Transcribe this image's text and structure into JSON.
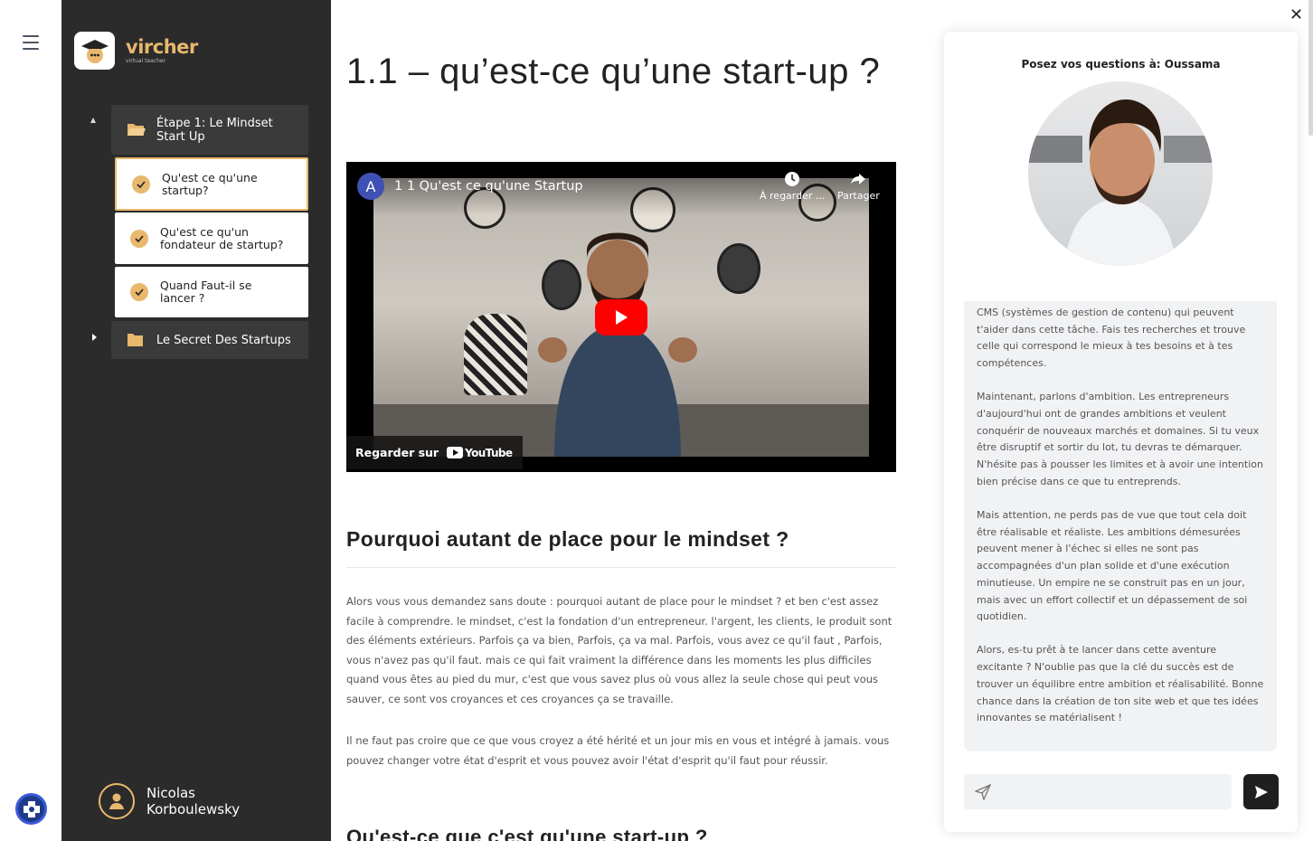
{
  "app": {
    "logo_name": "vircher",
    "logo_tagline": "virtual teacher"
  },
  "sidebar": {
    "modules": [
      {
        "label": "Étape 1: Le Mindset Start Up",
        "lessons": [
          {
            "label": "Qu'est ce qu'une startup?",
            "done": true,
            "active": true
          },
          {
            "label": "Qu'est ce qu'un fondateur de startup?",
            "done": true,
            "active": false
          },
          {
            "label": "Quand Faut-il se lancer ?",
            "done": true,
            "active": false
          }
        ]
      },
      {
        "label": "Le Secret Des Startups"
      }
    ],
    "user_name": "Nicolas Korboulewsky"
  },
  "main": {
    "title": "1.1 – qu’est-ce qu’une start-up ?",
    "video": {
      "channel_initial": "A",
      "title": "1 1 Qu'est ce qu'une Startup",
      "watch_later": "À regarder ...",
      "share": "Partager",
      "watch_on": "Regarder sur",
      "youtube": "YouTube"
    },
    "section1_title": "Pourquoi autant de place pour le mindset ?",
    "paragraph1": "Alors vous vous demandez sans doute : pourquoi autant de place pour le mindset ? et ben c'est assez facile à comprendre. le mindset, c'est la fondation d'un entrepreneur. l'argent, les clients, le produit sont des éléments extérieurs. Parfois ça va bien, Parfois, ça va mal. Parfois, vous avez ce qu'il faut , Parfois, vous n'avez pas qu'il faut. mais ce qui fait vraiment la différence dans les moments les plus difficiles quand vous êtes au pied du mur, c'est que vous savez plus où vous allez la seule chose qui peut vous sauver, ce sont vos croyances et ces croyances ça se travaille.",
    "paragraph2": "Il ne faut pas croire que ce que vous croyez a été hérité et un jour mis en vous et intégré à jamais. vous pouvez changer votre état d'esprit et vous pouvez avoir l'état d'esprit qu'il faut pour réussir.",
    "section2_title": "Qu'est-ce que c'est qu'une start-up ?"
  },
  "chat": {
    "title": "Posez vos questions à: Oussama",
    "messages": [
      "CMS (systèmes de gestion de contenu) qui peuvent t'aider dans cette tâche. Fais tes recherches et trouve celle qui correspond le mieux à tes besoins et à tes compétences.",
      "Maintenant, parlons d'ambition. Les entrepreneurs d'aujourd'hui ont de grandes ambitions et veulent conquérir de nouveaux marchés et domaines. Si tu veux être disruptif et sortir du lot, tu devras te démarquer. N'hésite pas à pousser les limites et à avoir une intention bien précise dans ce que tu entreprends.",
      "Mais attention, ne perds pas de vue que tout cela doit être réalisable et réaliste. Les ambitions démesurées peuvent mener à l'échec si elles ne sont pas accompagnées d'un plan solide et d'une exécution minutieuse. Un empire ne se construit pas en un jour, mais avec un effort collectif et un dépassement de soi quotidien.",
      "Alors, es-tu prêt à te lancer dans cette aventure excitante ? N'oublie pas que la clé du succès est de trouver un équilibre entre ambition et réalisabilité. Bonne chance dans la création de ton site web et que tes idées innovantes se matérialisent !"
    ],
    "input_placeholder": ""
  },
  "colors": {
    "accent": "#e8b86d",
    "sidebar_bg": "#2b2b2b",
    "youtube_red": "#ff0000"
  },
  "icons": [
    "hamburger-icon",
    "folder-icon",
    "check-icon",
    "user-icon",
    "clock-icon",
    "share-icon",
    "play-icon",
    "send-icon",
    "paper-plane-icon",
    "close-icon"
  ]
}
